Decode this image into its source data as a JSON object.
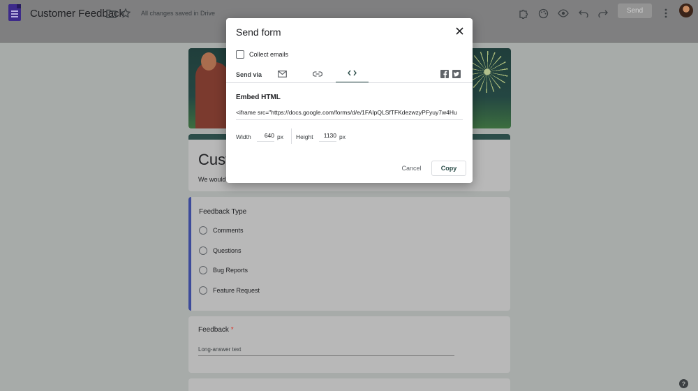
{
  "topbar": {
    "doc_title": "Customer Feedback",
    "saved_status": "All changes saved in Drive",
    "send_label": "Send",
    "icons": [
      "folder-icon",
      "star-icon",
      "addon-icon",
      "palette-icon",
      "preview-icon",
      "undo-icon",
      "redo-icon",
      "more-vert-icon"
    ]
  },
  "form": {
    "title": "Cust",
    "description": "We would",
    "questions": [
      {
        "title": "Feedback Type",
        "options": [
          "Comments",
          "Questions",
          "Bug Reports",
          "Feature Request"
        ]
      },
      {
        "title": "Feedback",
        "required_marker": "*",
        "placeholder": "Long-answer text"
      }
    ],
    "help_label": "?"
  },
  "dialog": {
    "title": "Send form",
    "collect_emails_label": "Collect emails",
    "send_via_label": "Send via",
    "tabs": [
      {
        "name": "email",
        "icon": "email-icon"
      },
      {
        "name": "link",
        "icon": "link-icon"
      },
      {
        "name": "embed",
        "icon": "embed-code-icon",
        "active": true
      }
    ],
    "social": [
      "facebook-icon",
      "twitter-icon"
    ],
    "embed_heading": "Embed HTML",
    "embed_code": "<iframe src=\"https://docs.google.com/forms/d/e/1FAIpQLSfTFKdezwzyPFyuy7w4Hu",
    "width_label": "Width",
    "width_value": "640",
    "height_label": "Height",
    "height_value": "1130",
    "unit": "px",
    "cancel_label": "Cancel",
    "copy_label": "Copy"
  },
  "colors": {
    "accent": "#2b4d49",
    "overlay": "#a7aba9"
  }
}
